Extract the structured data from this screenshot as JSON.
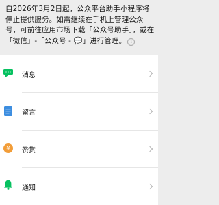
{
  "notice": {
    "text": "自2026年3月2日起，公众平台助手小程序将停止提供服务。如需继续在手机上管理公众号，可前往应用市场下载「公众号助手」，或在「微信」-「公众号 - 💬」进行管理。",
    "info_icon": "info-icon"
  },
  "menu": {
    "items": [
      {
        "label": "消息",
        "icon": "message-icon",
        "color": "#07c160"
      },
      {
        "label": "留言",
        "icon": "comment-icon",
        "color": "#3d8ee0"
      },
      {
        "label": "赞赏",
        "icon": "reward-yen-icon",
        "color": "#f29d38"
      },
      {
        "label": "通知",
        "icon": "bell-icon",
        "color": "#07c160"
      }
    ],
    "chevron_icon": "chevron-right-icon"
  }
}
